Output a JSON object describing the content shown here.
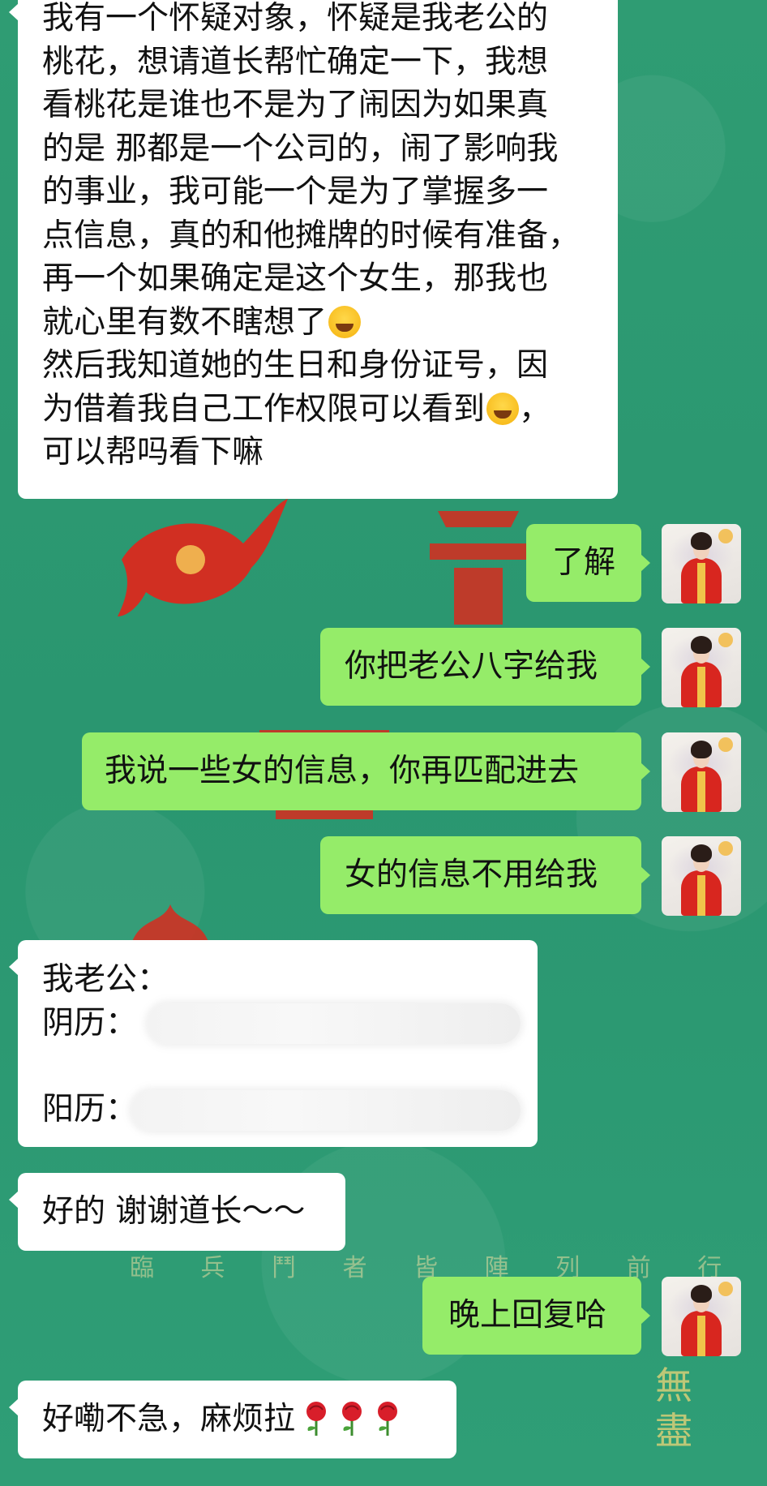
{
  "chat": {
    "messages": [
      {
        "side": "in",
        "lines": [
          "我有一个怀疑对象，怀疑是我老公的",
          "桃花，想请道长帮忙确定一下，我想",
          "看桃花是谁也不是为了闹因为如果真",
          "的是 那都是一个公司的，闹了影响我",
          "的事业，我可能一个是为了掌握多一",
          "点信息，真的和他摊牌的时候有准备，",
          "再一个如果确定是这个女生，那我也",
          "就心里有数不瞎想了",
          "然后我知道她的生日和身份证号，因",
          "为借着我自己工作权限可以看到",
          "，",
          "可以帮吗看下嘛"
        ],
        "emojis": [
          "crying-laughing-emoji",
          "grinning-sweat-emoji"
        ]
      },
      {
        "side": "out",
        "text": "了解"
      },
      {
        "side": "out",
        "text": "你把老公八字给我"
      },
      {
        "side": "out",
        "text": "我说一些女的信息，你再匹配进去"
      },
      {
        "side": "out",
        "text": "女的信息不用给我"
      },
      {
        "side": "in",
        "line1": "我老公：",
        "lunar_label": "阴历：",
        "solar_label": "阳历："
      },
      {
        "side": "in",
        "text": "好的 谢谢道长～～"
      },
      {
        "side": "out",
        "text": "晚上回复哈"
      },
      {
        "side": "in",
        "text": "好嘞不急，麻烦拉",
        "emojis": [
          "rose-emoji",
          "rose-emoji",
          "rose-emoji"
        ]
      }
    ]
  },
  "background": {
    "seal_text": "臨 兵 鬥 者 皆 陣 列 前 行",
    "side_text": "無盡"
  },
  "colors": {
    "background": "#2e9a72",
    "incoming_bubble": "#ffffff",
    "outgoing_bubble": "#95ec69"
  }
}
